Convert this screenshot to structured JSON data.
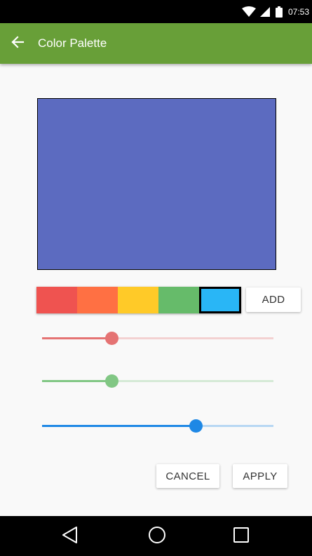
{
  "status_bar": {
    "time": "07:53",
    "icons": [
      "wifi-icon",
      "cell-signal-icon",
      "battery-icon"
    ]
  },
  "app_bar": {
    "title": "Color Palette",
    "back_icon": "arrow-back-icon",
    "color": "#689f38"
  },
  "preview": {
    "color": "#5c6bc0"
  },
  "palette": {
    "swatches": [
      {
        "color": "#ef5350",
        "selected": false
      },
      {
        "color": "#ff7043",
        "selected": false
      },
      {
        "color": "#ffca28",
        "selected": false
      },
      {
        "color": "#66bb6a",
        "selected": false
      },
      {
        "color": "#29b6f6",
        "selected": true
      }
    ],
    "add_label": "ADD"
  },
  "sliders": [
    {
      "name": "red",
      "color": "#e57373",
      "value": 0.3
    },
    {
      "name": "green",
      "color": "#81c784",
      "value": 0.3
    },
    {
      "name": "blue",
      "color": "#1e88e5",
      "value": 0.665
    }
  ],
  "actions": {
    "cancel_label": "CANCEL",
    "apply_label": "APPLY"
  },
  "nav_bar": {
    "icons": [
      "back-triangle-icon",
      "home-circle-icon",
      "recents-square-icon"
    ]
  }
}
